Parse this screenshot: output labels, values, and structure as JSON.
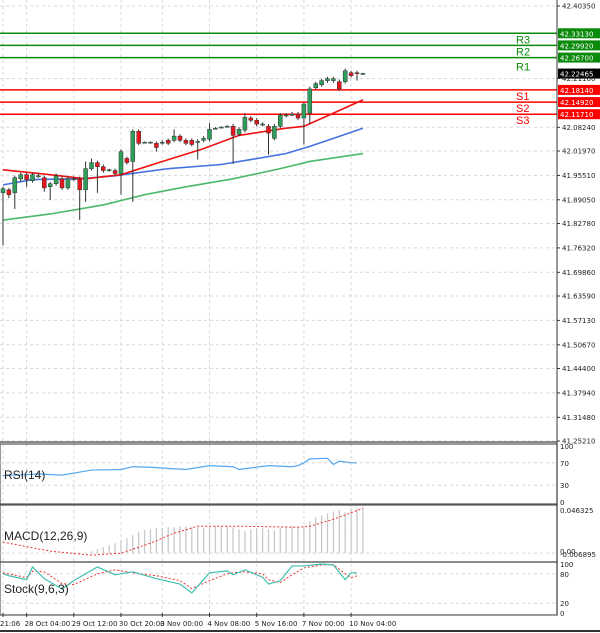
{
  "chart_data": {
    "type": "candlestick",
    "price_axis": {
      "range": [
        41.2521,
        42.4035
      ],
      "ticks": [
        "42.40350",
        "42.21160",
        "42.08240",
        "42.01970",
        "41.95510",
        "41.89050",
        "41.82780",
        "41.76320",
        "41.69860",
        "41.63590",
        "41.57130",
        "41.50670",
        "41.44400",
        "41.37940",
        "41.31480",
        "41.25210"
      ]
    },
    "time_axis": {
      "labels": [
        "21:06",
        "28 Oct 04:00",
        "29 Oct 12:00",
        "30 Oct 20:00",
        "3 Nov 00:00",
        "4 Nov 08:00",
        "5 Nov 16:00",
        "7 Nov 00:00",
        "10 Nov 04:00"
      ],
      "label_candle_index": [
        0,
        4,
        12,
        20,
        27,
        35,
        43,
        51,
        59
      ]
    },
    "colors": {
      "up": "#2e9e5b",
      "down": "#e8161b",
      "wick": "#333333",
      "resistance": "#0a8a0a",
      "support": "#ff0000",
      "current": "#000000",
      "ma_fast": "#ee1111",
      "ma_mid": "#4472e0",
      "ma_slow": "#4cb86a",
      "rsi": "#55a8f0",
      "macd_hist": "#c8c8c8",
      "macd_signal": "#ee3333",
      "stoch_main": "#40c0b0",
      "stoch_signal": "#ee3333",
      "grid": "#d8d8d8"
    },
    "candles": [
      [
        41.909,
        41.925,
        41.77,
        41.92
      ],
      [
        41.917,
        41.922,
        41.895,
        41.904
      ],
      [
        41.909,
        41.954,
        41.866,
        41.949
      ],
      [
        41.946,
        41.962,
        41.938,
        41.957
      ],
      [
        41.957,
        41.962,
        41.925,
        41.944
      ],
      [
        41.941,
        41.962,
        41.936,
        41.957
      ],
      [
        41.954,
        41.96,
        41.949,
        41.954
      ],
      [
        41.949,
        41.954,
        41.912,
        41.922
      ],
      [
        41.925,
        41.938,
        41.89,
        41.933
      ],
      [
        41.933,
        41.96,
        41.928,
        41.954
      ],
      [
        41.946,
        41.952,
        41.917,
        41.922
      ],
      [
        41.922,
        41.952,
        41.917,
        41.946
      ],
      [
        41.946,
        41.952,
        41.941,
        41.946
      ],
      [
        41.946,
        41.952,
        41.837,
        41.917
      ],
      [
        41.917,
        41.992,
        41.885,
        41.973
      ],
      [
        41.973,
        42.0,
        41.968,
        41.989
      ],
      [
        41.989,
        41.994,
        41.909,
        41.978
      ],
      [
        41.978,
        41.984,
        41.962,
        41.968
      ],
      [
        41.97,
        41.973,
        41.965,
        41.97
      ],
      [
        41.968,
        41.973,
        41.954,
        41.96
      ],
      [
        41.96,
        42.024,
        41.904,
        42.018
      ],
      [
        42.0,
        42.005,
        41.984,
        41.989
      ],
      [
        41.992,
        42.077,
        41.885,
        42.072
      ],
      [
        42.072,
        42.077,
        42.035,
        42.04
      ],
      [
        42.043,
        42.045,
        42.04,
        42.043
      ],
      [
        42.043,
        42.045,
        42.04,
        42.043
      ],
      [
        42.04,
        42.045,
        42.018,
        42.029
      ],
      [
        42.043,
        42.048,
        42.037,
        42.043
      ],
      [
        42.048,
        42.053,
        42.035,
        42.04
      ],
      [
        42.048,
        42.077,
        42.043,
        42.059
      ],
      [
        42.059,
        42.064,
        42.043,
        42.048
      ],
      [
        42.048,
        42.053,
        42.035,
        42.04
      ],
      [
        42.048,
        42.053,
        42.032,
        42.037
      ],
      [
        42.045,
        42.051,
        41.997,
        42.045
      ],
      [
        42.048,
        42.059,
        42.043,
        42.053
      ],
      [
        42.051,
        42.093,
        42.045,
        42.077
      ],
      [
        42.08,
        42.083,
        42.077,
        42.08
      ],
      [
        42.083,
        42.085,
        42.08,
        42.083
      ],
      [
        42.085,
        42.088,
        42.083,
        42.085
      ],
      [
        42.085,
        42.091,
        41.986,
        42.061
      ],
      [
        42.064,
        42.083,
        42.059,
        42.077
      ],
      [
        42.075,
        42.12,
        42.069,
        42.109
      ],
      [
        42.107,
        42.112,
        42.096,
        42.101
      ],
      [
        42.101,
        42.107,
        42.085,
        42.091
      ],
      [
        42.091,
        42.096,
        42.085,
        42.091
      ],
      [
        42.085,
        42.091,
        42.01,
        42.067
      ],
      [
        42.053,
        42.091,
        42.048,
        42.085
      ],
      [
        42.085,
        42.12,
        42.08,
        42.115
      ],
      [
        42.115,
        42.12,
        42.109,
        42.115
      ],
      [
        42.117,
        42.123,
        42.112,
        42.117
      ],
      [
        42.117,
        42.123,
        42.101,
        42.107
      ],
      [
        42.107,
        42.147,
        42.037,
        42.144
      ],
      [
        42.12,
        42.19,
        42.091,
        42.184
      ],
      [
        42.187,
        42.203,
        42.182,
        42.198
      ],
      [
        42.195,
        42.211,
        42.19,
        42.206
      ],
      [
        42.206,
        42.216,
        42.2,
        42.211
      ],
      [
        42.206,
        42.216,
        42.2,
        42.211
      ],
      [
        42.203,
        42.209,
        42.179,
        42.184
      ],
      [
        42.203,
        42.238,
        42.198,
        42.232
      ],
      [
        42.227,
        42.232,
        42.214,
        42.219
      ],
      [
        42.227,
        42.232,
        42.206,
        42.225
      ],
      [
        42.225,
        42.227,
        42.222,
        42.225
      ]
    ],
    "moving_averages": {
      "fast": [
        [
          0,
          41.97
        ],
        [
          8,
          41.957
        ],
        [
          14,
          41.946
        ],
        [
          20,
          41.957
        ],
        [
          27,
          41.992
        ],
        [
          34,
          42.026
        ],
        [
          40,
          42.061
        ],
        [
          48,
          42.08
        ],
        [
          51,
          42.085
        ],
        [
          56,
          42.12
        ],
        [
          61,
          42.155
        ]
      ],
      "mid": [
        [
          0,
          41.93
        ],
        [
          5,
          41.944
        ],
        [
          13,
          41.946
        ],
        [
          19,
          41.954
        ],
        [
          28,
          41.973
        ],
        [
          37,
          41.984
        ],
        [
          42,
          41.997
        ],
        [
          48,
          42.013
        ],
        [
          52,
          42.032
        ],
        [
          56,
          42.053
        ],
        [
          61,
          42.08
        ]
      ],
      "slow": [
        [
          0,
          41.837
        ],
        [
          8,
          41.853
        ],
        [
          17,
          41.877
        ],
        [
          24,
          41.904
        ],
        [
          31,
          41.925
        ],
        [
          39,
          41.946
        ],
        [
          47,
          41.973
        ],
        [
          52,
          41.992
        ],
        [
          61,
          42.013
        ]
      ]
    },
    "levels": [
      {
        "name": "R3",
        "value": "42.33130",
        "type": "resistance"
      },
      {
        "name": "R2",
        "value": "42.29920",
        "type": "resistance"
      },
      {
        "name": "R1",
        "value": "42.26700",
        "type": "resistance"
      },
      {
        "name": "S1",
        "value": "42.18140",
        "type": "support"
      },
      {
        "name": "S2",
        "value": "42.14920",
        "type": "support"
      },
      {
        "name": "S3",
        "value": "42.11710",
        "type": "support"
      }
    ],
    "current_price": "42.22465",
    "rsi": {
      "label": "RSI(14)",
      "ticks": [
        "100",
        "70",
        "30",
        "0"
      ],
      "points": [
        [
          0,
          47
        ],
        [
          6,
          50
        ],
        [
          10,
          48
        ],
        [
          15,
          57
        ],
        [
          20,
          58
        ],
        [
          22,
          63
        ],
        [
          25,
          62
        ],
        [
          31,
          58
        ],
        [
          35,
          65
        ],
        [
          39,
          63
        ],
        [
          40,
          58
        ],
        [
          45,
          65
        ],
        [
          49,
          63
        ],
        [
          50,
          65
        ],
        [
          51,
          70
        ],
        [
          52,
          77
        ],
        [
          55,
          78
        ],
        [
          56,
          67
        ],
        [
          57,
          73
        ],
        [
          59,
          70
        ],
        [
          60,
          70
        ]
      ]
    },
    "macd": {
      "label": "MACD(12,26,9)",
      "ticks": [
        "0.046325",
        "0.00",
        "-0.006895"
      ],
      "range": [
        -0.006895,
        0.046325
      ],
      "histogram": [
        0,
        0,
        0,
        0,
        0,
        0,
        0,
        0,
        0,
        0,
        0,
        0,
        0,
        0,
        0,
        0.002,
        0.004,
        0.006,
        0.008,
        0.01,
        0.013,
        0.015,
        0.018,
        0.021,
        0.023,
        0.024,
        0.025,
        0.025,
        0.026,
        0.026,
        0.027,
        0.027,
        0.026,
        0.026,
        0.025,
        0.026,
        0.027,
        0.027,
        0.027,
        0.026,
        0.024,
        0.022,
        0.024,
        0.025,
        0.025,
        0.024,
        0.023,
        0.025,
        0.027,
        0.027,
        0.026,
        0.027,
        0.032,
        0.036,
        0.038,
        0.04,
        0.042,
        0.043,
        0.041,
        0.045,
        0.045,
        0.046
      ],
      "signal": [
        [
          0,
          0.011
        ],
        [
          8,
          0.002
        ],
        [
          15,
          -0.002
        ],
        [
          20,
          0.0
        ],
        [
          25,
          0.01
        ],
        [
          29,
          0.02
        ],
        [
          33,
          0.027
        ],
        [
          40,
          0.027
        ],
        [
          50,
          0.026
        ],
        [
          52,
          0.027
        ],
        [
          56,
          0.034
        ],
        [
          61,
          0.045
        ]
      ]
    },
    "stochastic": {
      "label": "Stock(9,6,3)",
      "ticks": [
        "100",
        "80",
        "20",
        "0"
      ],
      "main": [
        [
          0,
          80
        ],
        [
          1,
          76
        ],
        [
          4,
          68
        ],
        [
          5,
          94
        ],
        [
          7,
          70
        ],
        [
          10,
          49
        ],
        [
          12,
          66
        ],
        [
          16,
          94
        ],
        [
          19,
          78
        ],
        [
          22,
          84
        ],
        [
          26,
          70
        ],
        [
          30,
          59
        ],
        [
          32,
          41
        ],
        [
          35,
          82
        ],
        [
          38,
          86
        ],
        [
          39,
          78
        ],
        [
          41,
          88
        ],
        [
          44,
          73
        ],
        [
          45,
          59
        ],
        [
          47,
          66
        ],
        [
          49,
          96
        ],
        [
          51,
          96
        ],
        [
          54,
          100
        ],
        [
          56,
          98
        ],
        [
          58,
          68
        ],
        [
          59,
          82
        ],
        [
          60,
          82
        ]
      ],
      "signal": [
        [
          0,
          82
        ],
        [
          1,
          80
        ],
        [
          4,
          72
        ],
        [
          5,
          85
        ],
        [
          7,
          84
        ],
        [
          10,
          60
        ],
        [
          12,
          58
        ],
        [
          16,
          80
        ],
        [
          19,
          88
        ],
        [
          22,
          82
        ],
        [
          26,
          76
        ],
        [
          30,
          66
        ],
        [
          32,
          50
        ],
        [
          35,
          66
        ],
        [
          38,
          80
        ],
        [
          39,
          82
        ],
        [
          41,
          84
        ],
        [
          44,
          80
        ],
        [
          45,
          68
        ],
        [
          47,
          62
        ],
        [
          49,
          78
        ],
        [
          51,
          92
        ],
        [
          54,
          98
        ],
        [
          56,
          99
        ],
        [
          58,
          80
        ],
        [
          59,
          72
        ],
        [
          60,
          76
        ]
      ]
    }
  }
}
